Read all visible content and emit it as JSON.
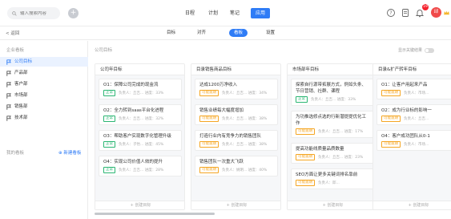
{
  "topbar": {
    "search_placeholder": "输入搜索内容",
    "nav": [
      "日程",
      "计划",
      "笔记",
      "应用"
    ],
    "active_nav": "应用",
    "notif_count": "19",
    "avatar_text": "邱"
  },
  "subbar": {
    "back": "< 返回",
    "tabs": [
      "目标",
      "对齐",
      "看板",
      "设置"
    ],
    "active_tab": "看板"
  },
  "sidebar": {
    "heading": "企业看板",
    "items": [
      {
        "label": "公司目标",
        "active": true
      },
      {
        "label": "产品部",
        "active": false
      },
      {
        "label": "客户部",
        "active": false
      },
      {
        "label": "市场部",
        "active": false
      },
      {
        "label": "销售部",
        "active": false
      },
      {
        "label": "技术部",
        "active": false
      }
    ],
    "mine_label": "我的看板",
    "new_board": "⊕ 新建看板"
  },
  "main": {
    "title": "公司目标",
    "kr_toggle_label": "显示关键结果"
  },
  "columns": [
    {
      "title": "公司年目标",
      "footer": "+ 创建目标",
      "cards": [
        {
          "title": "O1：保障公司完成的现金流",
          "tag": "正常",
          "tag_color": "green",
          "meta": "负责人：丘吉...   进度：33%"
        },
        {
          "title": "O2：全力转到saas平台化进程",
          "tag": "正常",
          "tag_color": "green",
          "meta": "负责人：丘吉...   进度：32%"
        },
        {
          "title": "O3：帮助客户实现数字化管理升级",
          "tag": "正常",
          "tag_color": "green",
          "meta": "负责人：子怡...   进度：45%"
        },
        {
          "title": "O4：实现公司价值人效的提升",
          "tag": "正常",
          "tag_color": "green",
          "meta": "负责人：丘吉...   进度：28%"
        }
      ]
    },
    {
      "title": "目录销售商品目标",
      "footer": "+ 创建目标",
      "cards": [
        {
          "title": "达成1200万净收入",
          "tag": "可能逾期",
          "tag_color": "orange",
          "meta": "负责人：丘吉...   进度：34%"
        },
        {
          "title": "销售业绩每大幅度增加",
          "tag": "可能逾期",
          "tag_color": "orange",
          "meta": "负责人：丘吉...   进度：38%"
        },
        {
          "title": "打造行业内有竞争力的销售团队",
          "tag": "可能逾期",
          "tag_color": "orange",
          "meta": "负责人：丘吉...   进度：38%"
        },
        {
          "title": "销售团队一次重大飞跃",
          "tag": "可能逾期",
          "tag_color": "orange",
          "meta": "负责人：姚明...   进度：40%"
        }
      ]
    },
    {
      "title": "市场部年目标",
      "footer": "+ 创建目标",
      "cards": [
        {
          "title": "探索自行源带拓展方式，例如头条、",
          "title2": "节日营销、社群、课程",
          "tag": "正常",
          "tag_color": "green",
          "meta": "负责人：丘吉...   进度：33%"
        },
        {
          "title": "为功推选修点选的行新潜提提优化工",
          "title2": "作",
          "tag": "可能逾期",
          "tag_color": "orange",
          "meta": "负责人：丘吉...   进度：17%"
        },
        {
          "title": "提高功能线质量品质数量",
          "tag": "可能逾期",
          "tag_color": "orange",
          "meta": "负责人：丘吉...   进度：23%"
        },
        {
          "title": "SEO方面让更多关键词排名靠前",
          "tag": "可能逾期",
          "tag_color": "orange",
          "meta": "负责人：邱..."
        }
      ]
    },
    {
      "title": "目录&扩产转年目标",
      "footer": "+ 创建目标",
      "cards": [
        {
          "title": "O1：让客户用起来产品",
          "tag": "可能逾期",
          "tag_color": "orange",
          "meta": "负责人：市场..."
        },
        {
          "title": "O2：成为行业标的影响一",
          "tag": "可能逾期",
          "tag_color": "orange",
          "meta": "负责人：丘吉..."
        },
        {
          "title": "O4：客户成功团队从0-1",
          "tag": "可能逾期",
          "tag_color": "orange",
          "meta": "负责人：市场..."
        }
      ]
    }
  ]
}
